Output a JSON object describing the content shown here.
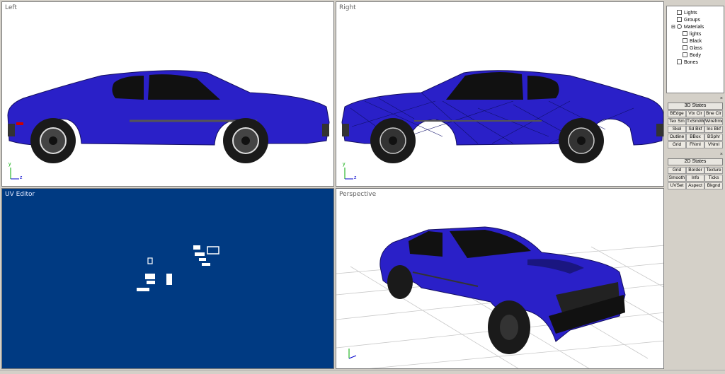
{
  "viewports": {
    "left": {
      "title": "Left"
    },
    "right": {
      "title": "Right"
    },
    "uv": {
      "title": "UV Editor"
    },
    "perspective": {
      "title": "Perspective"
    }
  },
  "axis": {
    "y": "y",
    "z": "z"
  },
  "scene_tree": {
    "lights": "Lights",
    "groups": "Groups",
    "materials": "Materials",
    "mat_lights": "lights",
    "mat_black": "Black",
    "mat_glass": "Glass",
    "mat_body": "Body",
    "bones": "Bones"
  },
  "states3d": {
    "header": "3D States",
    "buttons": [
      "BEdge",
      "Vtx Clr",
      "Bne Clr",
      "Tex Sm",
      "TxSmWr",
      "Wirefrme",
      "Skel",
      "Sd Bkf",
      "Inc Bkf",
      "Outline",
      "BBox",
      "BSphr",
      "Grid",
      "FNmI",
      "VNmI"
    ]
  },
  "states2d": {
    "header": "2D States",
    "buttons": [
      "Grid",
      "Border",
      "Texture",
      "Smooth",
      "Info",
      "Ticks",
      "UVSet",
      "Aspect",
      "Bkgnd"
    ]
  },
  "close_glyph": "×",
  "colors": {
    "car_body": "#2a20c8",
    "uv_background": "#003a82",
    "panel_bg": "#d4d0c8"
  }
}
